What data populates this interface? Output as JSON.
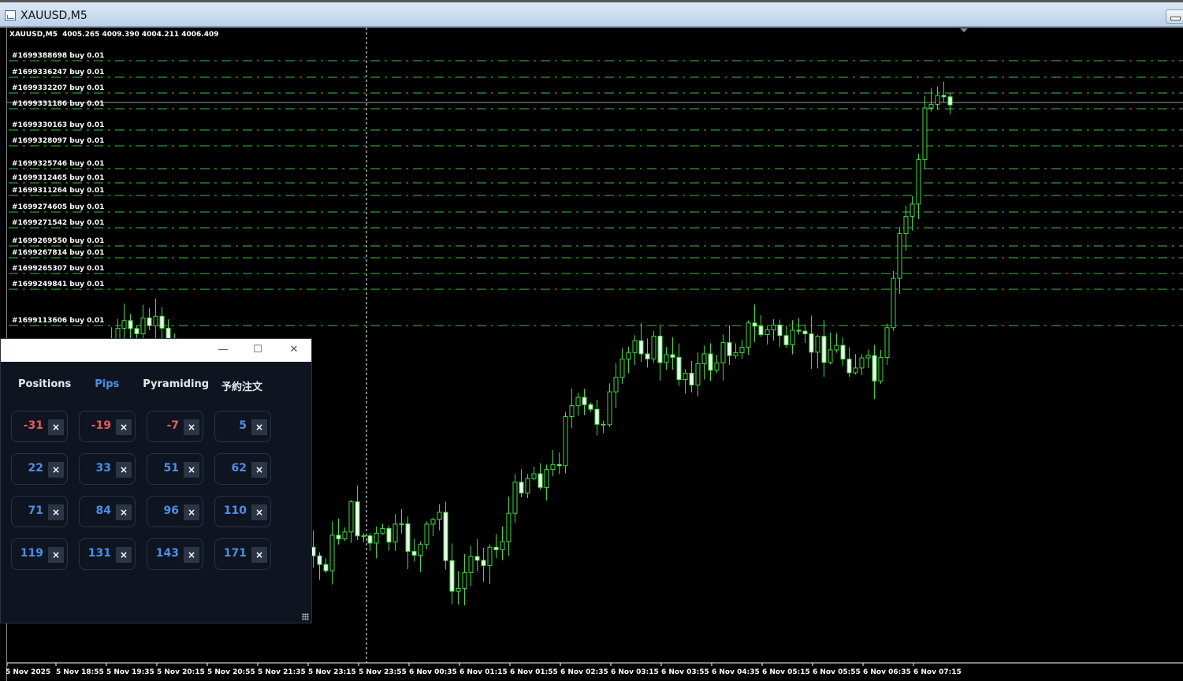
{
  "window": {
    "title": "XAUUSD,M5"
  },
  "chart": {
    "symbol_line": "XAUUSD,M5  4005.265 4009.390 4004.211 4006.409",
    "colors": {
      "candle": "#3ddc3d",
      "order_line": "#3fbf3f",
      "bid_line": "#9a9a9a",
      "background": "#000000"
    },
    "orders": [
      "#1699388698 buy  0.01",
      "#1699336247 buy  0.01",
      "#1699332207 buy  0.01",
      "#1699331186 buy  0.01",
      "#1699330163 buy  0.01",
      "#1699328097 buy  0.01",
      "#1699325746 buy  0.01",
      "#1699312465 buy  0.01",
      "#1699311264 buy  0.01",
      "#1699274605 buy  0.01",
      "#1699271542 buy  0.01",
      "#1699269550 buy  0.01",
      "#1699267814 buy  0.01",
      "#1699265307 buy  0.01",
      "#1699249841 buy  0.01",
      "#1699113606 buy  0.01"
    ],
    "time_labels": [
      "5 Nov 2025",
      "5 Nov 18:55",
      "5 Nov 19:35",
      "5 Nov 20:15",
      "5 Nov 20:55",
      "5 Nov 21:35",
      "5 Nov 23:15",
      "5 Nov 23:55",
      "6 Nov 00:35",
      "6 Nov 01:15",
      "6 Nov 01:55",
      "6 Nov 02:35",
      "6 Nov 03:15",
      "6 Nov 03:55",
      "6 Nov 04:35",
      "6 Nov 05:15",
      "6 Nov 05:55",
      "6 Nov 06:35",
      "6 Nov 07:15"
    ]
  },
  "panel": {
    "tabs": [
      {
        "label": "Positions",
        "active": false
      },
      {
        "label": "Pips",
        "active": true
      },
      {
        "label": "Pyramiding",
        "active": false
      },
      {
        "label": "予約注文",
        "active": false
      }
    ],
    "close_symbol": "×",
    "pips": [
      "-31",
      "-19",
      "-7",
      "5",
      "22",
      "33",
      "51",
      "62",
      "71",
      "84",
      "96",
      "110",
      "119",
      "131",
      "143",
      "171"
    ]
  }
}
